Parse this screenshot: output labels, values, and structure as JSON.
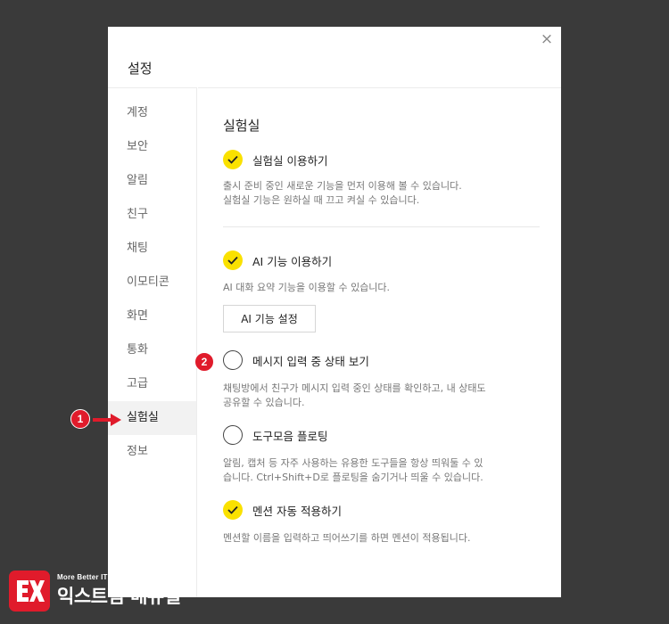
{
  "dialog": {
    "title": "설정",
    "close_symbol": "×"
  },
  "sidebar": {
    "items": [
      {
        "label": "계정"
      },
      {
        "label": "보안"
      },
      {
        "label": "알림"
      },
      {
        "label": "친구"
      },
      {
        "label": "채팅"
      },
      {
        "label": "이모티콘"
      },
      {
        "label": "화면"
      },
      {
        "label": "통화"
      },
      {
        "label": "고급"
      },
      {
        "label": "실험실"
      },
      {
        "label": "정보"
      }
    ],
    "active": "실험실"
  },
  "content": {
    "title": "실험실",
    "lab_option": {
      "label": "실험실 이용하기",
      "checked": true,
      "desc_line1": "출시 준비 중인 새로운 기능을 먼저 이용해 볼 수 있습니다.",
      "desc_line2": "실험실 기능은 원하실 때 끄고 켜실 수 있습니다."
    },
    "ai_option": {
      "label": "AI 기능 이용하기",
      "checked": true,
      "desc": "AI 대화 요약 기능을 이용할 수 있습니다.",
      "button_label": "AI 기능 설정"
    },
    "typing_option": {
      "label": "메시지 입력 중 상태 보기",
      "checked": false,
      "desc_line1": "채팅방에서 친구가 메시지 입력 중인 상태를 확인하고, 내 상태도",
      "desc_line2": "공유할 수 있습니다."
    },
    "toolbar_option": {
      "label": "도구모음 플로팅",
      "checked": false,
      "desc_line1": "알림, 캡처 등 자주 사용하는 유용한 도구들을 항상 띄워둘 수 있",
      "desc_line2": "습니다. Ctrl+Shift+D로 플로팅을 숨기거나 띄울 수 있습니다."
    },
    "mention_option": {
      "label": "멘션 자동 적용하기",
      "checked": true,
      "desc": "멘션할 이름을 입력하고 띄어쓰기를 하면 멘션이 적용됩니다."
    }
  },
  "annotations": {
    "badge1": "1",
    "badge2": "2",
    "color": "#e01b2b"
  },
  "logo": {
    "tagline": "More Better IT Life",
    "name": "익스트림 매뉴얼"
  },
  "colors": {
    "check_yellow": "#fae100",
    "background": "#3a3a3a"
  }
}
